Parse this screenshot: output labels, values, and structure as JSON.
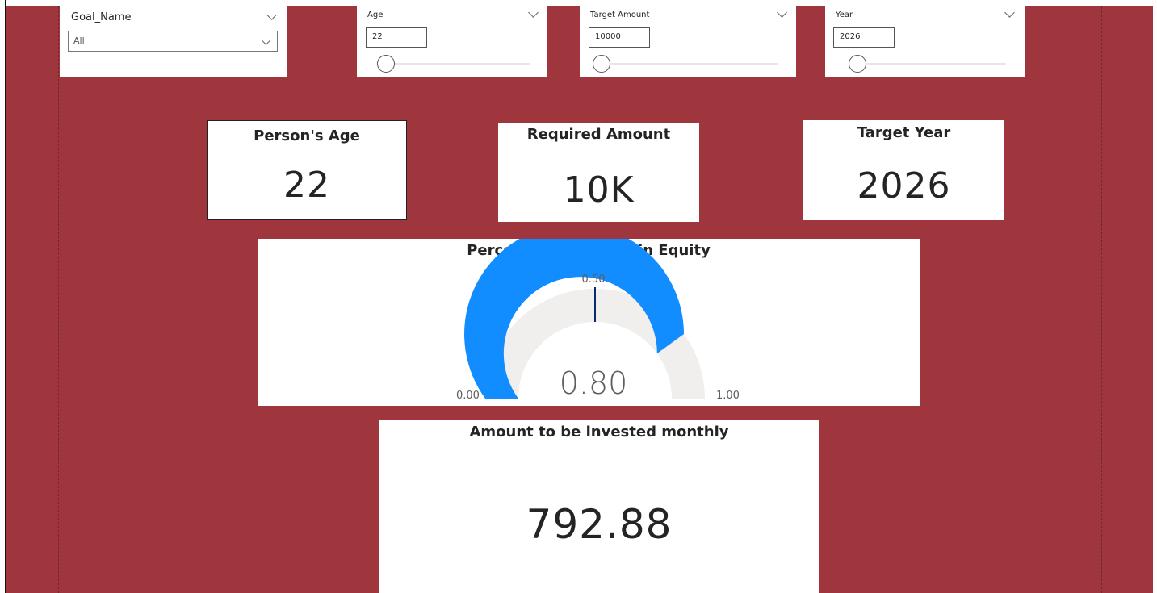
{
  "slicers": {
    "goal": {
      "title": "Goal_Name",
      "value": "All"
    },
    "age": {
      "title": "Age",
      "value": "22"
    },
    "target_amount": {
      "title": "Target Amount",
      "value": "10000"
    },
    "year": {
      "title": "Year",
      "value": "2026"
    }
  },
  "cards": {
    "age": {
      "title": "Person's Age",
      "value": "22"
    },
    "amount": {
      "title": "Required Amount",
      "value": "10K"
    },
    "year": {
      "title": "Target Year",
      "value": "2026"
    },
    "monthly": {
      "title": "Amount to be invested monthly",
      "value": "792.88"
    }
  },
  "gauge": {
    "title": "Percentage of funds in Equity",
    "min": 0,
    "max": 1,
    "value": 0.8,
    "target": 0.5,
    "min_label": "0.00",
    "max_label": "1.00",
    "value_label": "0.80",
    "target_label": "0.50"
  },
  "colors": {
    "background": "#9f353d",
    "gauge_fill": "#118dff",
    "gauge_track": "#f0efee",
    "target_line": "#0b2a6b"
  }
}
